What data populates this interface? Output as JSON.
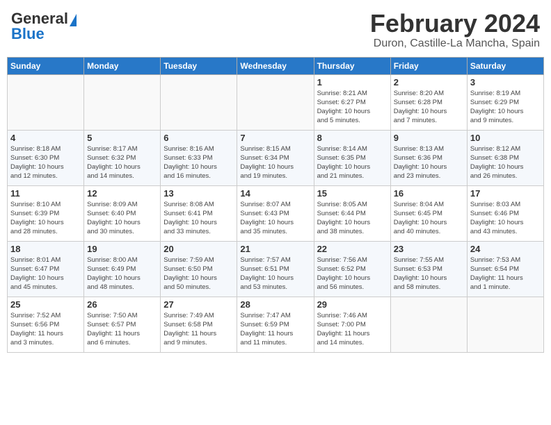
{
  "header": {
    "logo_general": "General",
    "logo_blue": "Blue",
    "month": "February 2024",
    "location": "Duron, Castille-La Mancha, Spain"
  },
  "weekdays": [
    "Sunday",
    "Monday",
    "Tuesday",
    "Wednesday",
    "Thursday",
    "Friday",
    "Saturday"
  ],
  "weeks": [
    [
      {
        "day": "",
        "info": ""
      },
      {
        "day": "",
        "info": ""
      },
      {
        "day": "",
        "info": ""
      },
      {
        "day": "",
        "info": ""
      },
      {
        "day": "1",
        "info": "Sunrise: 8:21 AM\nSunset: 6:27 PM\nDaylight: 10 hours\nand 5 minutes."
      },
      {
        "day": "2",
        "info": "Sunrise: 8:20 AM\nSunset: 6:28 PM\nDaylight: 10 hours\nand 7 minutes."
      },
      {
        "day": "3",
        "info": "Sunrise: 8:19 AM\nSunset: 6:29 PM\nDaylight: 10 hours\nand 9 minutes."
      }
    ],
    [
      {
        "day": "4",
        "info": "Sunrise: 8:18 AM\nSunset: 6:30 PM\nDaylight: 10 hours\nand 12 minutes."
      },
      {
        "day": "5",
        "info": "Sunrise: 8:17 AM\nSunset: 6:32 PM\nDaylight: 10 hours\nand 14 minutes."
      },
      {
        "day": "6",
        "info": "Sunrise: 8:16 AM\nSunset: 6:33 PM\nDaylight: 10 hours\nand 16 minutes."
      },
      {
        "day": "7",
        "info": "Sunrise: 8:15 AM\nSunset: 6:34 PM\nDaylight: 10 hours\nand 19 minutes."
      },
      {
        "day": "8",
        "info": "Sunrise: 8:14 AM\nSunset: 6:35 PM\nDaylight: 10 hours\nand 21 minutes."
      },
      {
        "day": "9",
        "info": "Sunrise: 8:13 AM\nSunset: 6:36 PM\nDaylight: 10 hours\nand 23 minutes."
      },
      {
        "day": "10",
        "info": "Sunrise: 8:12 AM\nSunset: 6:38 PM\nDaylight: 10 hours\nand 26 minutes."
      }
    ],
    [
      {
        "day": "11",
        "info": "Sunrise: 8:10 AM\nSunset: 6:39 PM\nDaylight: 10 hours\nand 28 minutes."
      },
      {
        "day": "12",
        "info": "Sunrise: 8:09 AM\nSunset: 6:40 PM\nDaylight: 10 hours\nand 30 minutes."
      },
      {
        "day": "13",
        "info": "Sunrise: 8:08 AM\nSunset: 6:41 PM\nDaylight: 10 hours\nand 33 minutes."
      },
      {
        "day": "14",
        "info": "Sunrise: 8:07 AM\nSunset: 6:43 PM\nDaylight: 10 hours\nand 35 minutes."
      },
      {
        "day": "15",
        "info": "Sunrise: 8:05 AM\nSunset: 6:44 PM\nDaylight: 10 hours\nand 38 minutes."
      },
      {
        "day": "16",
        "info": "Sunrise: 8:04 AM\nSunset: 6:45 PM\nDaylight: 10 hours\nand 40 minutes."
      },
      {
        "day": "17",
        "info": "Sunrise: 8:03 AM\nSunset: 6:46 PM\nDaylight: 10 hours\nand 43 minutes."
      }
    ],
    [
      {
        "day": "18",
        "info": "Sunrise: 8:01 AM\nSunset: 6:47 PM\nDaylight: 10 hours\nand 45 minutes."
      },
      {
        "day": "19",
        "info": "Sunrise: 8:00 AM\nSunset: 6:49 PM\nDaylight: 10 hours\nand 48 minutes."
      },
      {
        "day": "20",
        "info": "Sunrise: 7:59 AM\nSunset: 6:50 PM\nDaylight: 10 hours\nand 50 minutes."
      },
      {
        "day": "21",
        "info": "Sunrise: 7:57 AM\nSunset: 6:51 PM\nDaylight: 10 hours\nand 53 minutes."
      },
      {
        "day": "22",
        "info": "Sunrise: 7:56 AM\nSunset: 6:52 PM\nDaylight: 10 hours\nand 56 minutes."
      },
      {
        "day": "23",
        "info": "Sunrise: 7:55 AM\nSunset: 6:53 PM\nDaylight: 10 hours\nand 58 minutes."
      },
      {
        "day": "24",
        "info": "Sunrise: 7:53 AM\nSunset: 6:54 PM\nDaylight: 11 hours\nand 1 minute."
      }
    ],
    [
      {
        "day": "25",
        "info": "Sunrise: 7:52 AM\nSunset: 6:56 PM\nDaylight: 11 hours\nand 3 minutes."
      },
      {
        "day": "26",
        "info": "Sunrise: 7:50 AM\nSunset: 6:57 PM\nDaylight: 11 hours\nand 6 minutes."
      },
      {
        "day": "27",
        "info": "Sunrise: 7:49 AM\nSunset: 6:58 PM\nDaylight: 11 hours\nand 9 minutes."
      },
      {
        "day": "28",
        "info": "Sunrise: 7:47 AM\nSunset: 6:59 PM\nDaylight: 11 hours\nand 11 minutes."
      },
      {
        "day": "29",
        "info": "Sunrise: 7:46 AM\nSunset: 7:00 PM\nDaylight: 11 hours\nand 14 minutes."
      },
      {
        "day": "",
        "info": ""
      },
      {
        "day": "",
        "info": ""
      }
    ]
  ]
}
